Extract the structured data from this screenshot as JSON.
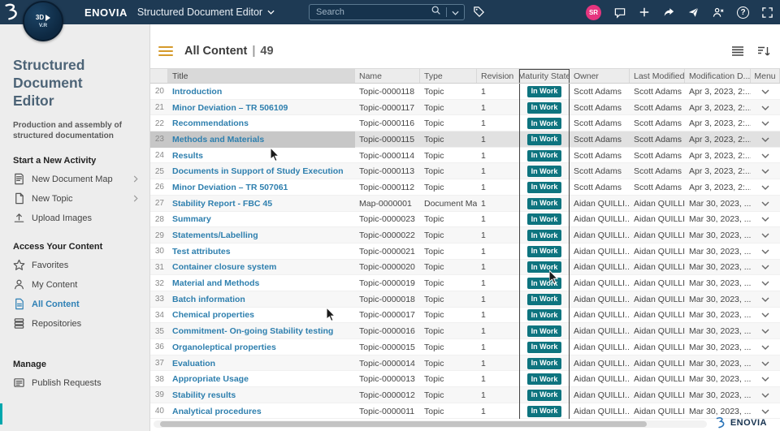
{
  "colors": {
    "topbar_navy": "#1e3a54",
    "avatar_pink": "#e6357f",
    "link_blue": "#2e7fae",
    "active_blue": "#2e80b5",
    "badge_teal": "#0e747f"
  },
  "topbar": {
    "brand": "ENOVIA",
    "app_title": "Structured Document Editor",
    "search_placeholder": "Search",
    "avatar_initials": "SR",
    "compass": {
      "label": "3D",
      "sub": "V.R"
    }
  },
  "sidebar": {
    "title": "Structured Document Editor",
    "subtitle": "Production and assembly of structured documentation",
    "sections": [
      {
        "header": "Start a New Activity",
        "items": [
          {
            "label": "New Document Map",
            "icon": "document-map-icon",
            "chevron": true
          },
          {
            "label": "New Topic",
            "icon": "new-topic-icon",
            "chevron": true
          },
          {
            "label": "Upload Images",
            "icon": "upload-icon"
          }
        ]
      },
      {
        "header": "Access Your Content",
        "items": [
          {
            "label": "Favorites",
            "icon": "star-icon"
          },
          {
            "label": "My Content",
            "icon": "person-icon"
          },
          {
            "label": "All Content",
            "icon": "document-icon",
            "active": true
          },
          {
            "label": "Repositories",
            "icon": "repository-icon"
          }
        ]
      },
      {
        "header": "Manage",
        "items": [
          {
            "label": "Publish Requests",
            "icon": "publish-icon"
          }
        ]
      }
    ]
  },
  "content": {
    "title": "All Content",
    "separator": "|",
    "count": "49",
    "columns": [
      "Title",
      "Name",
      "Type",
      "Revision",
      "Maturity State",
      "Owner",
      "Last Modified By",
      "Modification D...",
      "Menu"
    ],
    "rows": [
      {
        "num": 20,
        "title": "Introduction",
        "name": "Topic-0000118",
        "type": "Topic",
        "revision": "1",
        "state": "In Work",
        "owner": "Scott Adams",
        "modified_by": "Scott Adams",
        "date": "Apr 3, 2023, 2:..."
      },
      {
        "num": 21,
        "title": "Minor Deviation – TR 506109",
        "name": "Topic-0000117",
        "type": "Topic",
        "revision": "1",
        "state": "In Work",
        "owner": "Scott Adams",
        "modified_by": "Scott Adams",
        "date": "Apr 3, 2023, 2:..."
      },
      {
        "num": 22,
        "title": "Recommendations",
        "name": "Topic-0000116",
        "type": "Topic",
        "revision": "1",
        "state": "In Work",
        "owner": "Scott Adams",
        "modified_by": "Scott Adams",
        "date": "Apr 3, 2023, 2:..."
      },
      {
        "num": 23,
        "title": "Methods and Materials",
        "name": "Topic-0000115",
        "type": "Topic",
        "revision": "1",
        "state": "In Work",
        "owner": "Scott Adams",
        "modified_by": "Scott Adams",
        "date": "Apr 3, 2023, 2:...",
        "selected": true
      },
      {
        "num": 24,
        "title": "Results",
        "name": "Topic-0000114",
        "type": "Topic",
        "revision": "1",
        "state": "In Work",
        "owner": "Scott Adams",
        "modified_by": "Scott Adams",
        "date": "Apr 3, 2023, 2:..."
      },
      {
        "num": 25,
        "title": "Documents in Support of Study Execution",
        "name": "Topic-0000113",
        "type": "Topic",
        "revision": "1",
        "state": "In Work",
        "owner": "Scott Adams",
        "modified_by": "Scott Adams",
        "date": "Apr 3, 2023, 2:..."
      },
      {
        "num": 26,
        "title": "Minor Deviation – TR 507061",
        "name": "Topic-0000112",
        "type": "Topic",
        "revision": "1",
        "state": "In Work",
        "owner": "Scott Adams",
        "modified_by": "Scott Adams",
        "date": "Apr 3, 2023, 2:..."
      },
      {
        "num": 27,
        "title": "Stability Report - FBC 45",
        "name": "Map-0000001",
        "type": "Document Map",
        "revision": "1",
        "state": "In Work",
        "owner": "Aidan QUILLI...",
        "modified_by": "Aidan QUILLI...",
        "date": "Mar 30, 2023, ..."
      },
      {
        "num": 28,
        "title": "Summary",
        "name": "Topic-0000023",
        "type": "Topic",
        "revision": "1",
        "state": "In Work",
        "owner": "Aidan QUILLI...",
        "modified_by": "Aidan QUILLI...",
        "date": "Mar 30, 2023, ..."
      },
      {
        "num": 29,
        "title": "Statements/Labelling",
        "name": "Topic-0000022",
        "type": "Topic",
        "revision": "1",
        "state": "In Work",
        "owner": "Aidan QUILLI...",
        "modified_by": "Aidan QUILLI...",
        "date": "Mar 30, 2023, ..."
      },
      {
        "num": 30,
        "title": "Test attributes",
        "name": "Topic-0000021",
        "type": "Topic",
        "revision": "1",
        "state": "In Work",
        "owner": "Aidan QUILLI...",
        "modified_by": "Aidan QUILLI...",
        "date": "Mar 30, 2023, ..."
      },
      {
        "num": 31,
        "title": "Container closure system",
        "name": "Topic-0000020",
        "type": "Topic",
        "revision": "1",
        "state": "In Work",
        "owner": "Aidan QUILLI...",
        "modified_by": "Aidan QUILLI...",
        "date": "Mar 30, 2023, ..."
      },
      {
        "num": 32,
        "title": "Material and Methods",
        "name": "Topic-0000019",
        "type": "Topic",
        "revision": "1",
        "state": "In Work",
        "owner": "Aidan QUILLI...",
        "modified_by": "Aidan QUILLI...",
        "date": "Mar 30, 2023, ..."
      },
      {
        "num": 33,
        "title": "Batch information",
        "name": "Topic-0000018",
        "type": "Topic",
        "revision": "1",
        "state": "In Work",
        "owner": "Aidan QUILLI...",
        "modified_by": "Aidan QUILLI...",
        "date": "Mar 30, 2023, ..."
      },
      {
        "num": 34,
        "title": "Chemical properties",
        "name": "Topic-0000017",
        "type": "Topic",
        "revision": "1",
        "state": "In Work",
        "owner": "Aidan QUILLI...",
        "modified_by": "Aidan QUILLI...",
        "date": "Mar 30, 2023, ..."
      },
      {
        "num": 35,
        "title": "Commitment- On-going Stability testing",
        "name": "Topic-0000016",
        "type": "Topic",
        "revision": "1",
        "state": "In Work",
        "owner": "Aidan QUILLI...",
        "modified_by": "Aidan QUILLI...",
        "date": "Mar 30, 2023, ..."
      },
      {
        "num": 36,
        "title": "Organoleptical properties",
        "name": "Topic-0000015",
        "type": "Topic",
        "revision": "1",
        "state": "In Work",
        "owner": "Aidan QUILLI...",
        "modified_by": "Aidan QUILLI...",
        "date": "Mar 30, 2023, ..."
      },
      {
        "num": 37,
        "title": "Evaluation",
        "name": "Topic-0000014",
        "type": "Topic",
        "revision": "1",
        "state": "In Work",
        "owner": "Aidan QUILLI...",
        "modified_by": "Aidan QUILLI...",
        "date": "Mar 30, 2023, ..."
      },
      {
        "num": 38,
        "title": "Appropriate Usage",
        "name": "Topic-0000013",
        "type": "Topic",
        "revision": "1",
        "state": "In Work",
        "owner": "Aidan QUILLI...",
        "modified_by": "Aidan QUILLI...",
        "date": "Mar 30, 2023, ..."
      },
      {
        "num": 39,
        "title": "Stability results",
        "name": "Topic-0000012",
        "type": "Topic",
        "revision": "1",
        "state": "In Work",
        "owner": "Aidan QUILLI...",
        "modified_by": "Aidan QUILLI...",
        "date": "Mar 30, 2023, ..."
      },
      {
        "num": 40,
        "title": "Analytical procedures",
        "name": "Topic-0000011",
        "type": "Topic",
        "revision": "1",
        "state": "In Work",
        "owner": "Aidan QUILLI...",
        "modified_by": "Aidan QUILLI...",
        "date": "Mar 30, 2023, ..."
      }
    ]
  },
  "footer": {
    "brand": "ENOVIA"
  }
}
